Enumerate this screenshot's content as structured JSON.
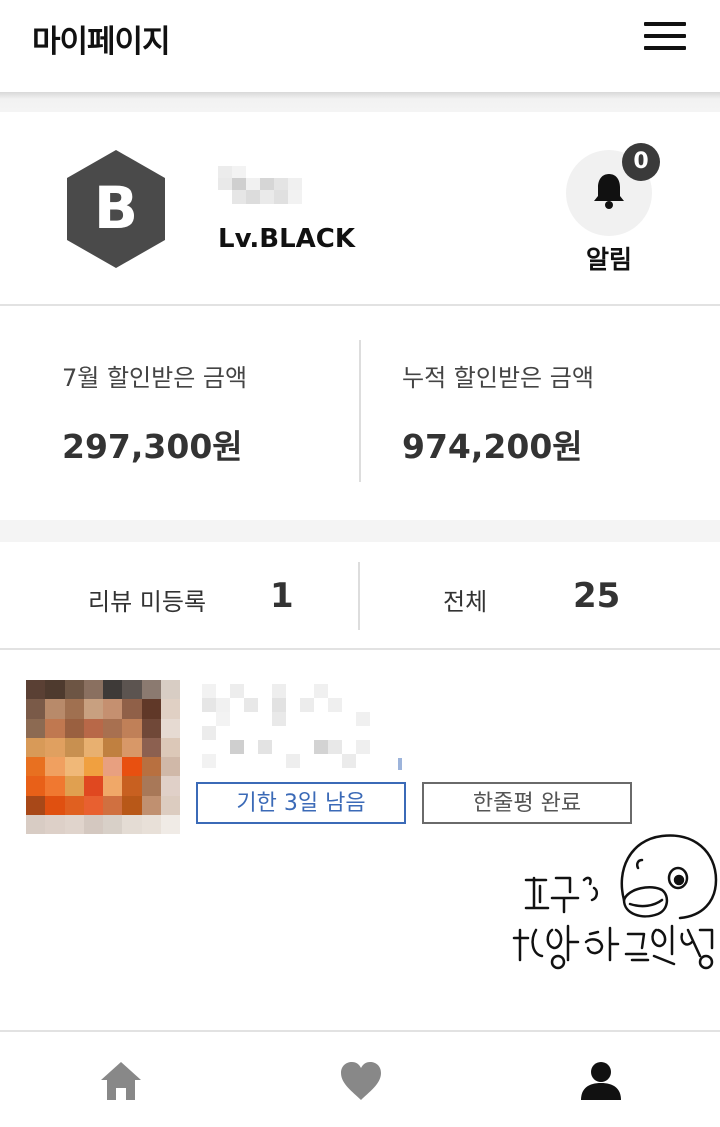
{
  "header": {
    "title": "마이페이지",
    "menu_icon": "hamburger-menu-icon"
  },
  "profile": {
    "avatar_letter": "B",
    "avatar_color": "#4a4a4a",
    "level": "Lv.BLACK",
    "notification": {
      "count": "0",
      "label": "알림",
      "icon": "bell-icon"
    }
  },
  "savings": {
    "monthly": {
      "label": "7월 할인받은 금액",
      "amount": "297,300원"
    },
    "total": {
      "label": "누적 할인받은 금액",
      "amount": "974,200원"
    }
  },
  "reviews": {
    "pending": {
      "label": "리뷰 미등록",
      "count": "1"
    },
    "all": {
      "label": "전체",
      "count": "25"
    }
  },
  "review_item": {
    "deadline_tag": "기한 3일 남음",
    "status_tag": "한줄평 완료"
  },
  "bottom_nav": [
    {
      "name": "home",
      "icon": "home-icon"
    },
    {
      "name": "wishlist",
      "icon": "heart-icon"
    },
    {
      "name": "my-page",
      "icon": "person-icon"
    }
  ],
  "colors": {
    "accent_blue": "#3b6ab7",
    "nav_active": "#111111",
    "nav_inactive": "#888888"
  }
}
